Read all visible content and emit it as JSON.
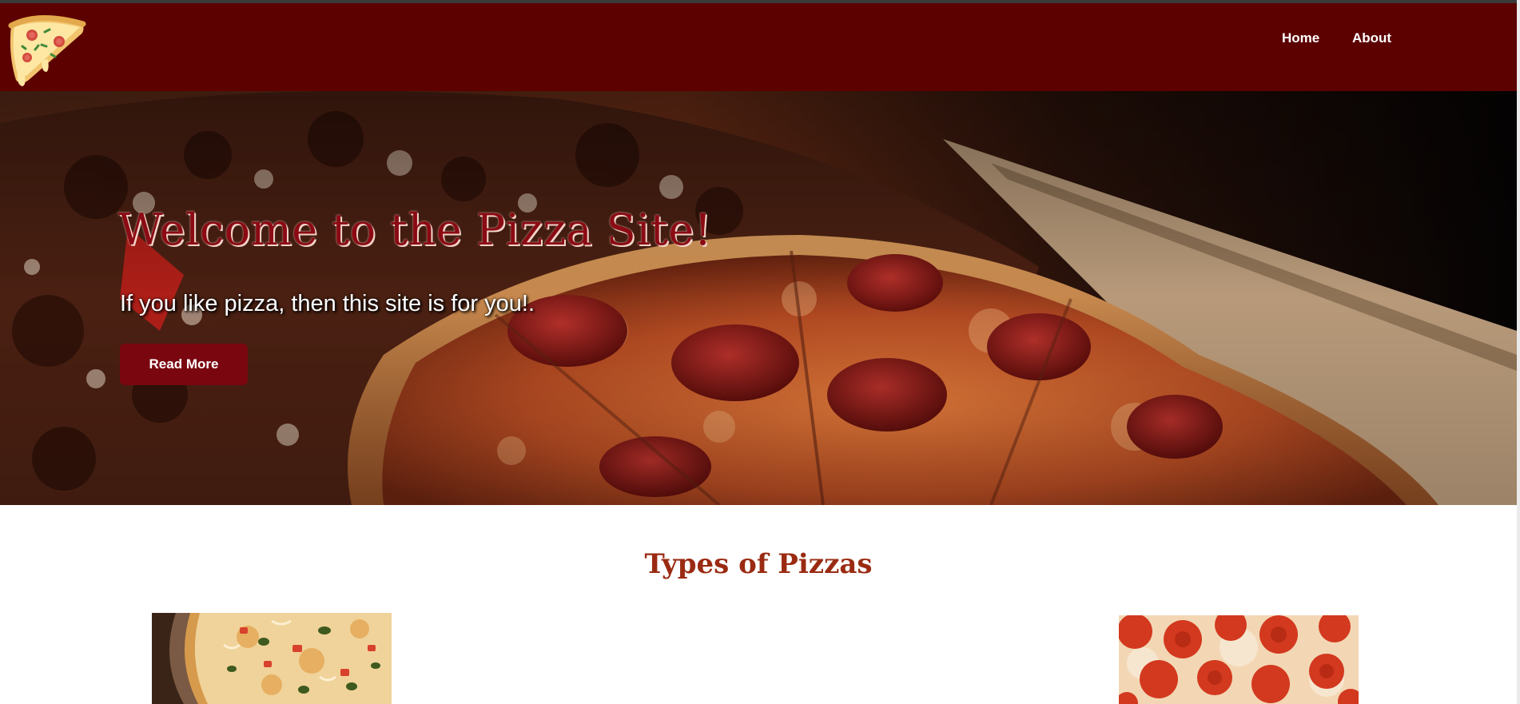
{
  "navbar": {
    "logo_icon": "pizza-slice-icon",
    "links": [
      {
        "label": "Home"
      },
      {
        "label": "About"
      }
    ],
    "background": "#5c0000"
  },
  "hero": {
    "title": "Welcome to the Pizza Site!",
    "subtitle": "If you like pizza, then this site is for you!.",
    "button_label": "Read More",
    "title_color": "#8b0a14",
    "button_color": "#7a0710"
  },
  "pizza_types": {
    "heading": "Types of Pizzas",
    "heading_color": "#9a2b12",
    "images": [
      {
        "icon": "veggie-pizza-image"
      },
      {
        "icon": "pepperoni-pizza-image"
      }
    ]
  }
}
